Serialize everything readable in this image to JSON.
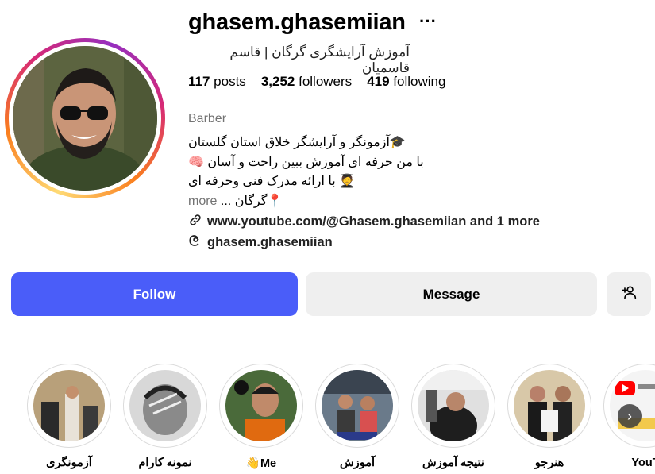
{
  "profile": {
    "username": "ghasem.ghasemiian",
    "more_icon": "ellipsis-icon",
    "full_name": "آموزش آرایشگری گرگان | قاسم قاسمیان",
    "stats": {
      "posts_count": "117",
      "posts_label": "posts",
      "followers_count": "3,252",
      "followers_label": "followers",
      "following_count": "419",
      "following_label": "following"
    },
    "category": "Barber",
    "bio": {
      "line1": "🎓آزمونگر و آرایشگر خلاق استان گلستان",
      "line2": "با من حرفه ای آموزش ببین راحت و آسان 🧠",
      "line3": "🧑‍🎓 با ارائه مدرک فنی وحرفه ای",
      "line4": "📍گرگان ...",
      "more": "more"
    },
    "link_text": "www.youtube.com/@Ghasem.ghasemiian and 1 more",
    "threads_handle": "ghasem.ghasemiian"
  },
  "actions": {
    "follow": "Follow",
    "message": "Message",
    "add_user_icon": "add-user-icon",
    "follow_color": "#4a5df9"
  },
  "highlights": [
    {
      "label": "آزمونگری"
    },
    {
      "label": "نمونه کارام"
    },
    {
      "label": "Me👋"
    },
    {
      "label": "آموزش"
    },
    {
      "label": "نتیجه آموزش"
    },
    {
      "label": "هنرجو"
    },
    {
      "label": "YouT"
    }
  ]
}
